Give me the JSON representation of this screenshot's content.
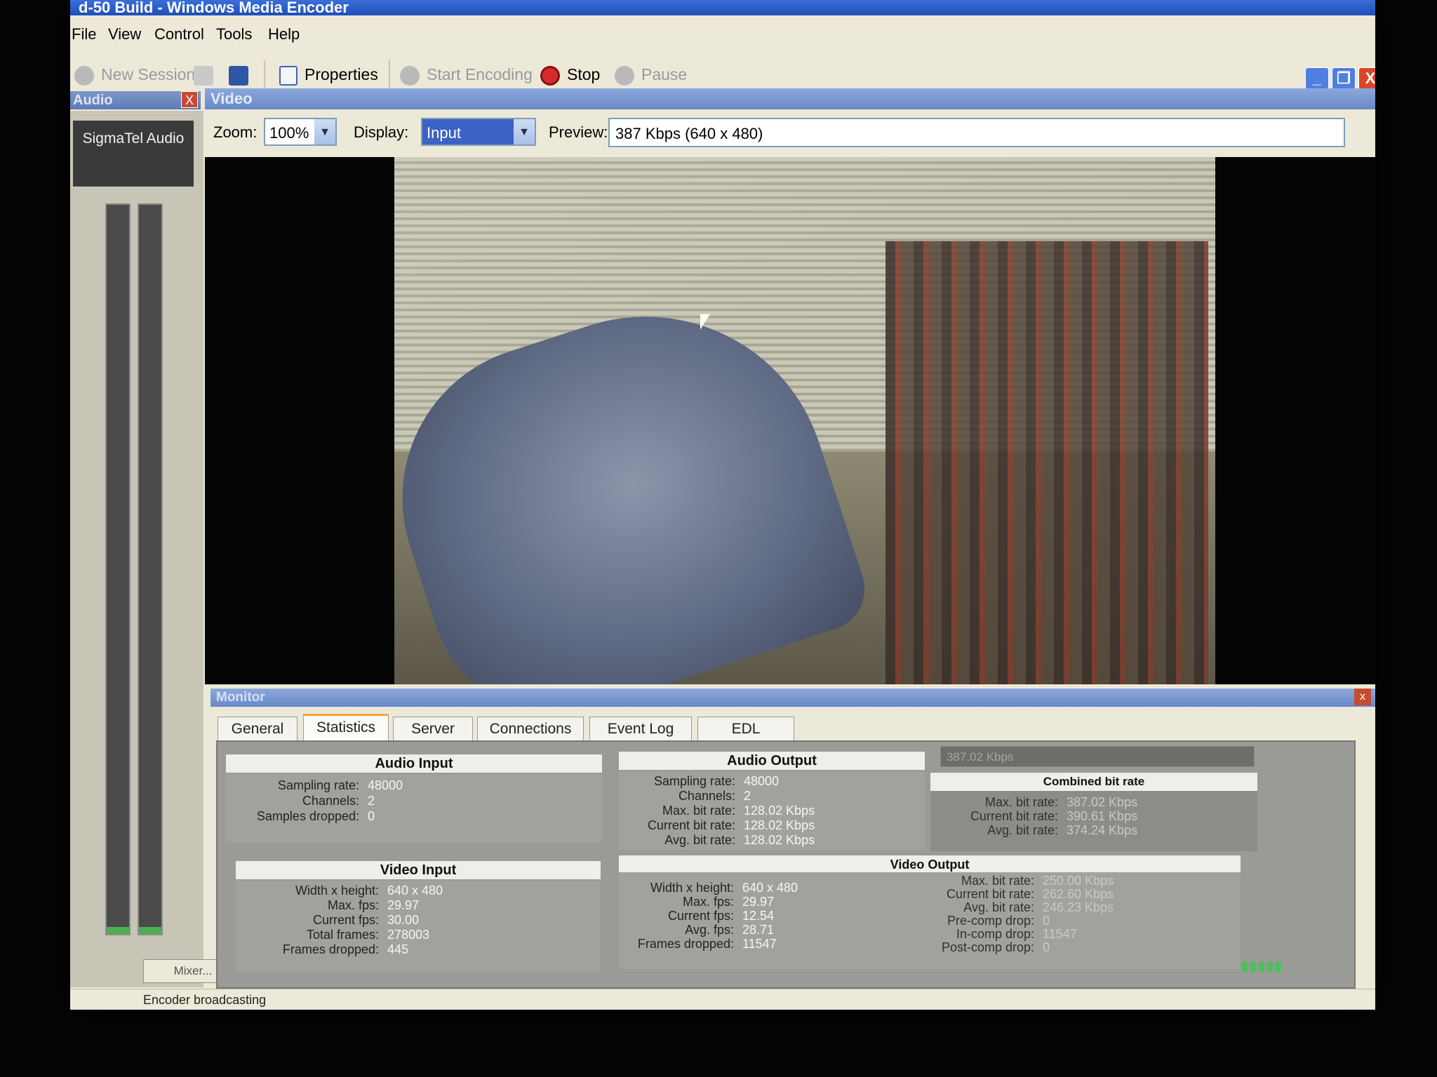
{
  "window": {
    "title": "d-50 Build - Windows Media Encoder",
    "controls": {
      "minimize": "_",
      "maximize": "❐",
      "close": "X"
    }
  },
  "menu": [
    "File",
    "View",
    "Control",
    "Tools",
    "Help"
  ],
  "toolbar": {
    "new_session": "New Session",
    "properties": "Properties",
    "start_encoding": "Start Encoding",
    "stop": "Stop",
    "pause": "Pause"
  },
  "audio": {
    "pane_title": "Audio",
    "close": "X",
    "device": "SigmaTel Audio",
    "mixer_button": "Mixer...",
    "meter_levels": [
      0.01,
      0.01
    ]
  },
  "video": {
    "pane_title": "Video",
    "zoom_label": "Zoom:",
    "zoom_value": "100%",
    "display_label": "Display:",
    "display_value": "Input",
    "preview_label": "Preview:",
    "preview_value": "387 Kbps (640 x 480)"
  },
  "monitor": {
    "pane_title": "Monitor",
    "close": "x",
    "tabs": [
      "General",
      "Statistics",
      "Server",
      "Connections",
      "Event Log",
      "EDL"
    ],
    "active_tab": "Statistics",
    "bitrate_combo": "387.02 Kbps",
    "audio_input": {
      "title": "Audio Input",
      "rows": [
        {
          "label": "Sampling rate:",
          "value": "48000"
        },
        {
          "label": "Channels:",
          "value": "2"
        },
        {
          "label": "Samples dropped:",
          "value": "0"
        }
      ]
    },
    "audio_output": {
      "title": "Audio Output",
      "rows": [
        {
          "label": "Sampling rate:",
          "value": "48000"
        },
        {
          "label": "Channels:",
          "value": "2"
        },
        {
          "label": "Max. bit rate:",
          "value": "128.02 Kbps"
        },
        {
          "label": "Current bit rate:",
          "value": "128.02 Kbps"
        },
        {
          "label": "Avg. bit rate:",
          "value": "128.02 Kbps"
        }
      ]
    },
    "combined_bit_rate": {
      "title": "Combined bit rate",
      "rows": [
        {
          "label": "Max. bit rate:",
          "value": "387.02 Kbps"
        },
        {
          "label": "Current bit rate:",
          "value": "390.61 Kbps"
        },
        {
          "label": "Avg. bit rate:",
          "value": "374.24 Kbps"
        }
      ]
    },
    "video_input": {
      "title": "Video Input",
      "rows": [
        {
          "label": "Width x height:",
          "value": "640 x 480"
        },
        {
          "label": "Max. fps:",
          "value": "29.97"
        },
        {
          "label": "Current fps:",
          "value": "30.00"
        },
        {
          "label": "Total frames:",
          "value": "278003"
        },
        {
          "label": "Frames dropped:",
          "value": "445"
        }
      ]
    },
    "video_output": {
      "title": "Video Output",
      "rows": [
        {
          "label": "Width x height:",
          "value": "640 x 480"
        },
        {
          "label": "Max. fps:",
          "value": "29.97"
        },
        {
          "label": "Current fps:",
          "value": "12.54"
        },
        {
          "label": "Avg. fps:",
          "value": "28.71"
        },
        {
          "label": "Frames dropped:",
          "value": "11547"
        }
      ],
      "rows_right": [
        {
          "label": "Max. bit rate:",
          "value": "250.00 Kbps"
        },
        {
          "label": "Current bit rate:",
          "value": "262.60 Kbps"
        },
        {
          "label": "Avg. bit rate:",
          "value": "246.23 Kbps"
        },
        {
          "label": "Pre-comp drop:",
          "value": "0"
        },
        {
          "label": "In-comp drop:",
          "value": "11547"
        },
        {
          "label": "Post-comp drop:",
          "value": "0"
        }
      ]
    }
  },
  "status": {
    "text": "Encoder broadcasting"
  },
  "colors": {
    "accent": "#3b63c6",
    "title_bar": "#1f4fb8",
    "stop": "#d62b2b"
  }
}
